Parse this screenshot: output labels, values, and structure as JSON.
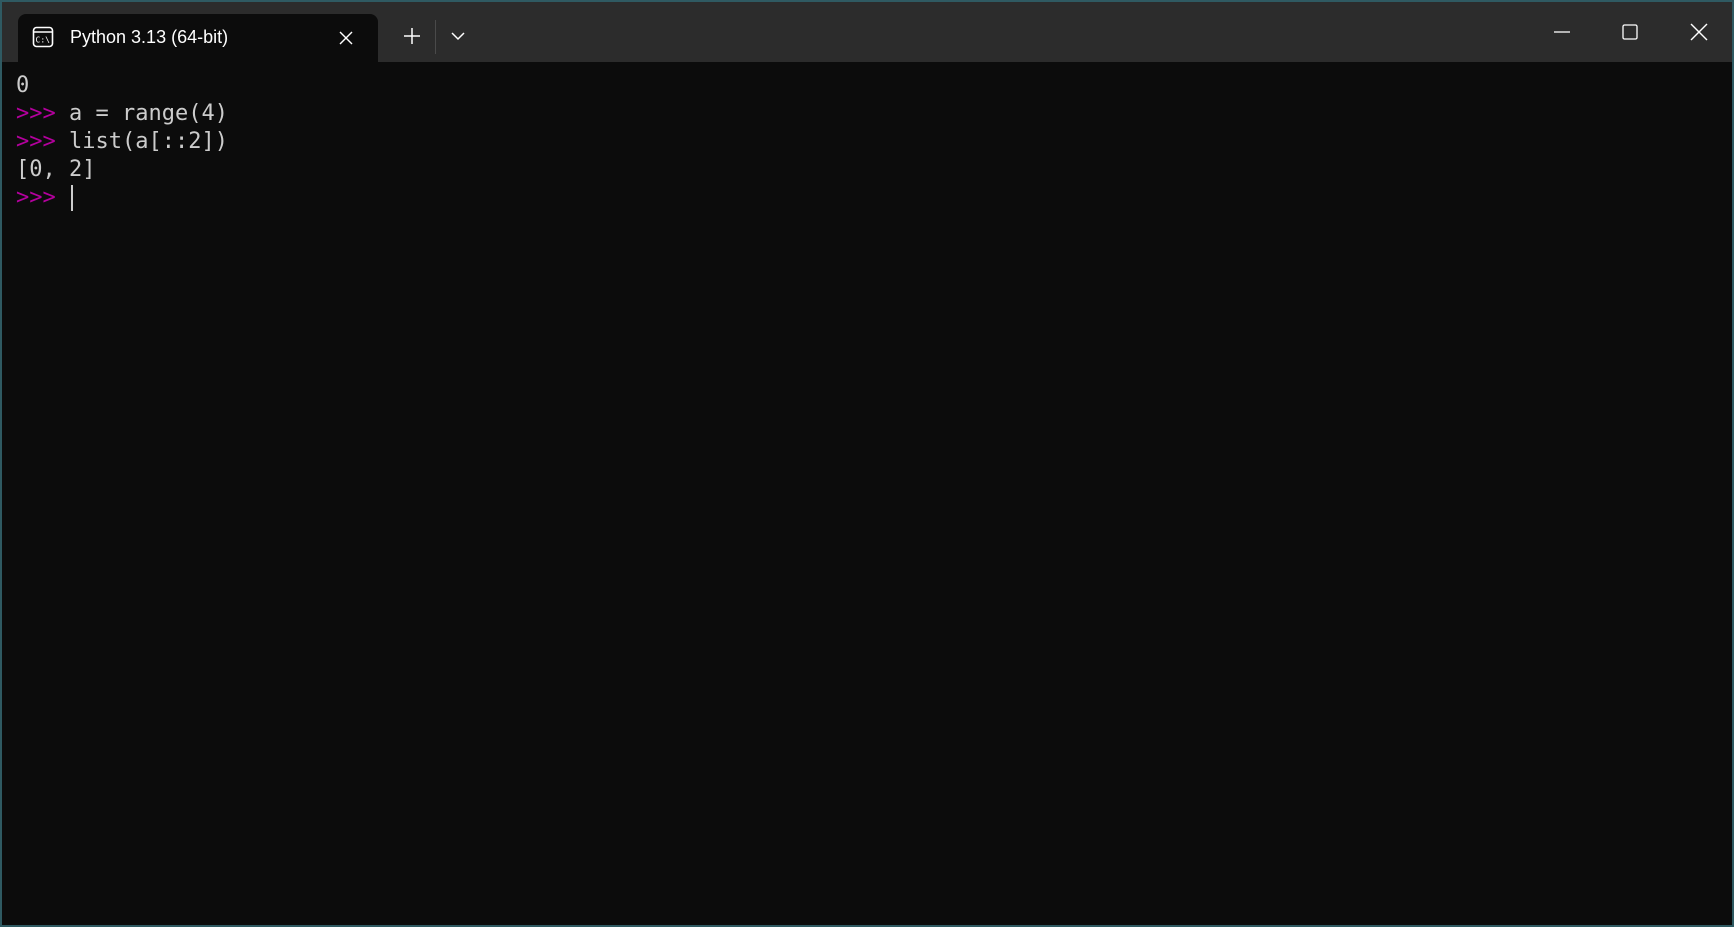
{
  "tab": {
    "title": "Python 3.13 (64-bit)",
    "icon": "console-icon"
  },
  "titlebar": {
    "new_tab_icon": "plus-icon",
    "dropdown_icon": "chevron-down-icon",
    "minimize_icon": "minimize-icon",
    "maximize_icon": "maximize-icon",
    "close_icon": "close-icon"
  },
  "terminal": {
    "prompt": ">>>",
    "lines": [
      {
        "prompt": "",
        "text": "0"
      },
      {
        "prompt": ">>>",
        "text": " a = range(4)"
      },
      {
        "prompt": ">>>",
        "text": " list(a[::2])"
      },
      {
        "prompt": "",
        "text": "[0, 2]"
      },
      {
        "prompt": ">>>",
        "text": " "
      }
    ]
  },
  "colors": {
    "background": "#0c0c0c",
    "titlebar": "#2c2c2c",
    "text": "#cccccc",
    "prompt": "#b4009e"
  }
}
